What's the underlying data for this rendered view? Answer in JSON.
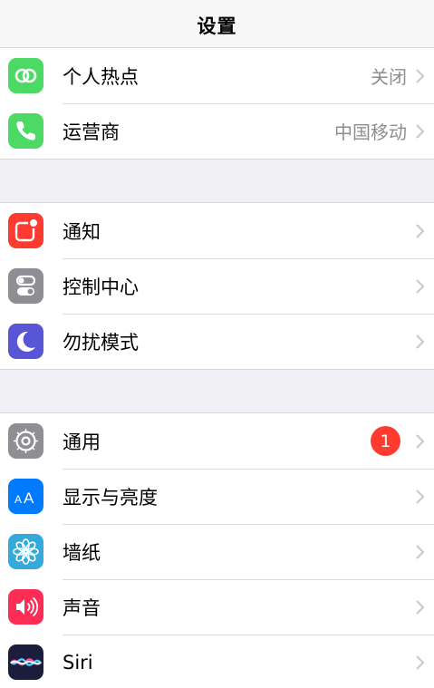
{
  "header": {
    "title": "设置"
  },
  "group1": {
    "items": [
      {
        "label": "个人热点",
        "value": "关闭",
        "icon": "hotspot-icon",
        "color": "#4cd964"
      },
      {
        "label": "运营商",
        "value": "中国移动",
        "icon": "phone-icon",
        "color": "#4cd964"
      }
    ]
  },
  "group2": {
    "items": [
      {
        "label": "通知",
        "icon": "notifications-icon",
        "color": "#ff3b30"
      },
      {
        "label": "控制中心",
        "icon": "control-center-icon",
        "color": "#8e8e93"
      },
      {
        "label": "勿扰模式",
        "icon": "moon-icon",
        "color": "#5856d6"
      }
    ]
  },
  "group3": {
    "items": [
      {
        "label": "通用",
        "badge": "1",
        "icon": "gear-icon",
        "color": "#8e8e93"
      },
      {
        "label": "显示与亮度",
        "icon": "display-aa-icon",
        "color": "#007aff"
      },
      {
        "label": "墙纸",
        "icon": "flower-icon",
        "color": "#34aadc"
      },
      {
        "label": "声音",
        "icon": "speaker-icon",
        "color": "#ff2d55"
      },
      {
        "label": "Siri",
        "icon": "siri-icon",
        "color": "#1c1c3c"
      }
    ]
  }
}
